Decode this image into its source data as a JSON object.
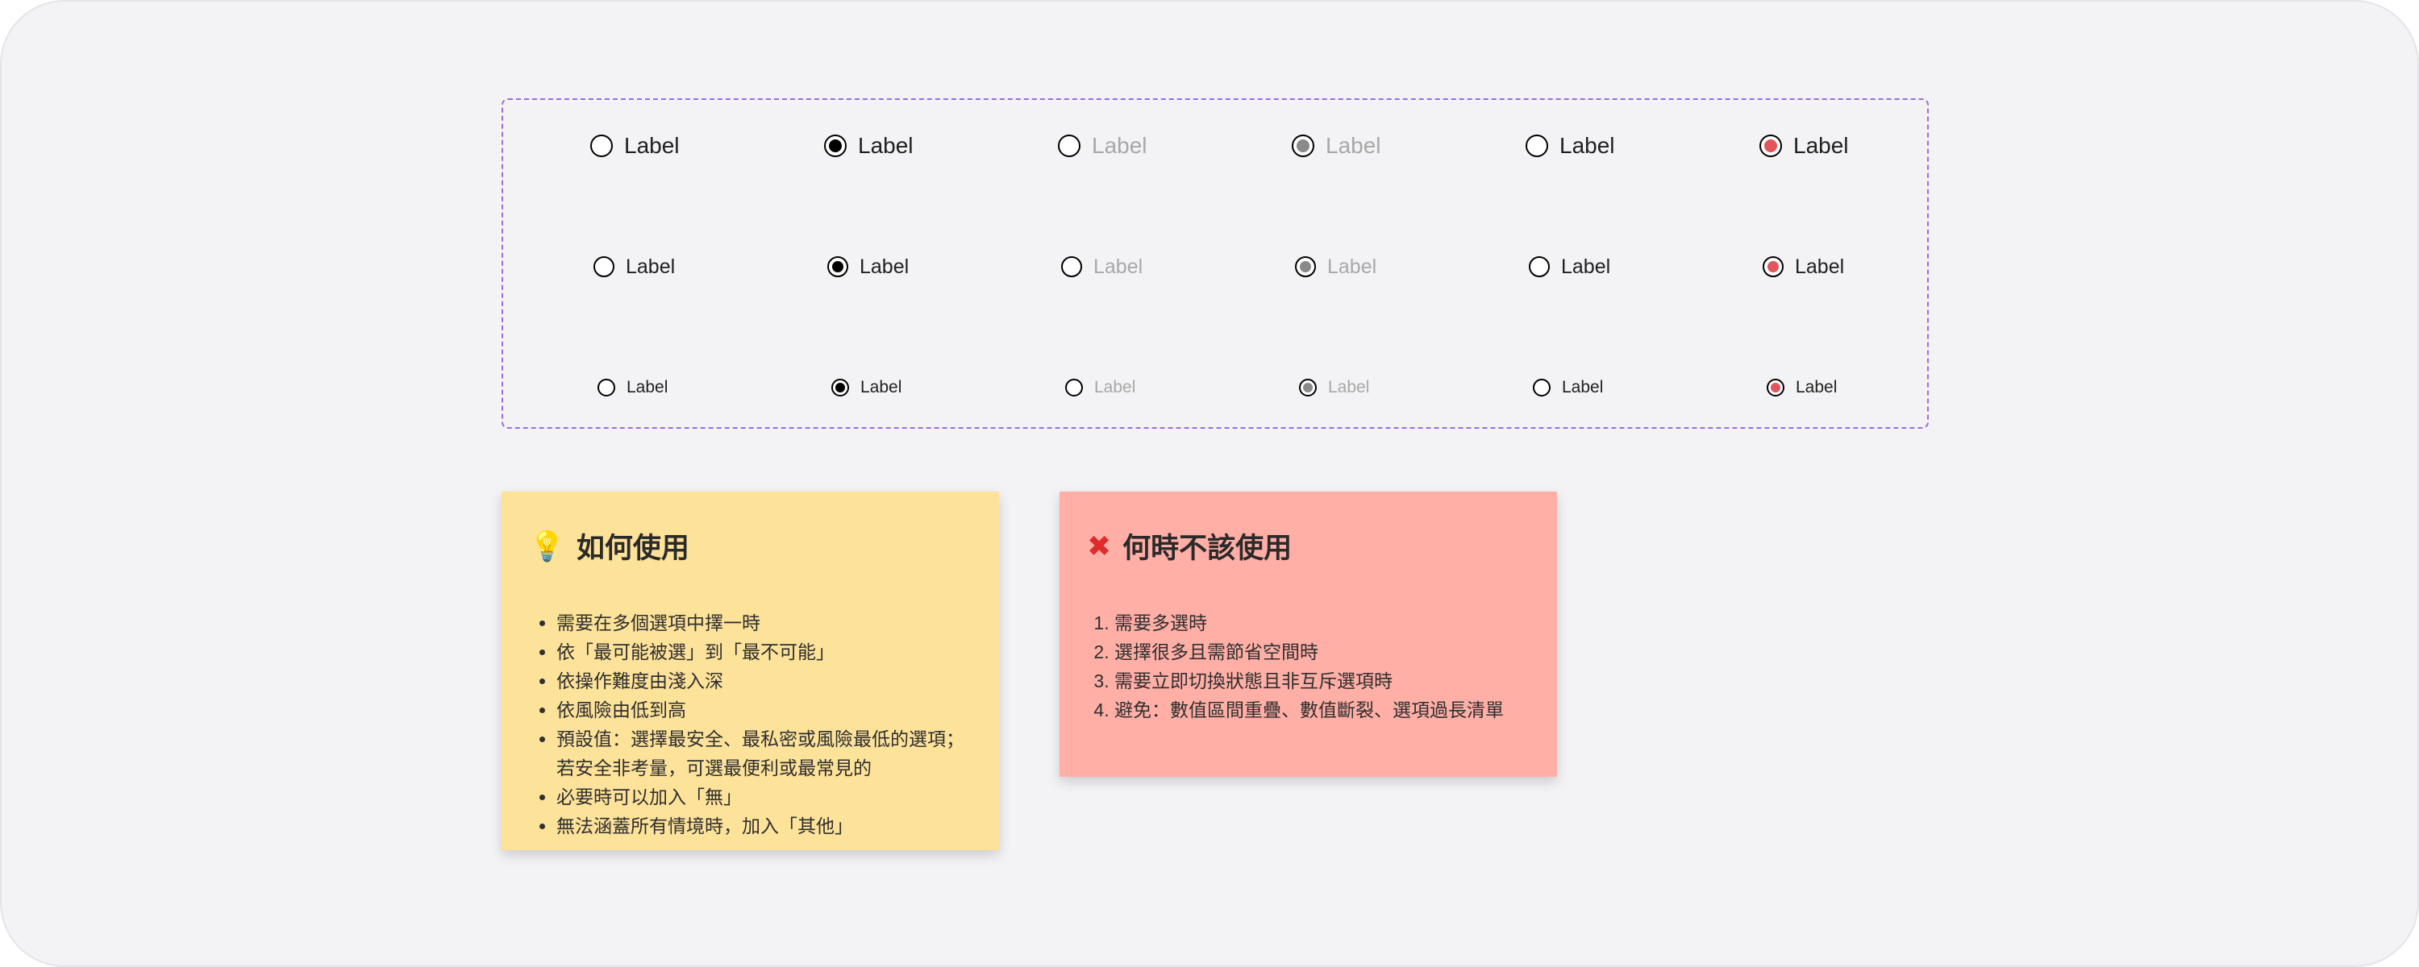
{
  "colors": {
    "page_background": "#f3f3f6",
    "panel_border": "#9b6be0",
    "selected": "#000000",
    "disabled": "#a8a8a8",
    "error": "#e0565b",
    "usage_note": "#fde29a",
    "avoid_note": "#ffafa6"
  },
  "radio_demo": {
    "rows": [
      {
        "size": "large",
        "items": [
          {
            "state": "default",
            "label": "Label"
          },
          {
            "state": "selected",
            "label": "Label"
          },
          {
            "state": "disabled",
            "label": "Label"
          },
          {
            "state": "disabled-selected",
            "label": "Label"
          },
          {
            "state": "error",
            "label": "Label"
          },
          {
            "state": "error-selected",
            "label": "Label"
          }
        ]
      },
      {
        "size": "medium",
        "items": [
          {
            "state": "default",
            "label": "Label"
          },
          {
            "state": "selected",
            "label": "Label"
          },
          {
            "state": "disabled",
            "label": "Label"
          },
          {
            "state": "disabled-selected",
            "label": "Label"
          },
          {
            "state": "error",
            "label": "Label"
          },
          {
            "state": "error-selected",
            "label": "Label"
          }
        ]
      },
      {
        "size": "small",
        "items": [
          {
            "state": "default",
            "label": "Label"
          },
          {
            "state": "selected",
            "label": "Label"
          },
          {
            "state": "disabled",
            "label": "Label"
          },
          {
            "state": "disabled-selected",
            "label": "Label"
          },
          {
            "state": "error",
            "label": "Label"
          },
          {
            "state": "error-selected",
            "label": "Label"
          }
        ]
      }
    ]
  },
  "usage_note": {
    "icon": "lightbulb-icon",
    "title": "如何使用",
    "items": [
      "需要在多個選項中擇一時",
      "依「最可能被選」到「最不可能」",
      "依操作難度由淺入深",
      "依風險由低到高",
      "預設值：選擇最安全、最私密或風險最低的選項；若安全非考量，可選最便利或最常見的",
      "必要時可以加入「無」",
      "無法涵蓋所有情境時，加入「其他」"
    ]
  },
  "avoid_note": {
    "icon": "cross-mark-icon",
    "title": "何時不該使用",
    "items": [
      "需要多選時",
      "選擇很多且需節省空間時",
      "需要立即切換狀態且非互斥選項時",
      " 避免：數值區間重疊、數值斷裂、選項過長清單"
    ]
  }
}
